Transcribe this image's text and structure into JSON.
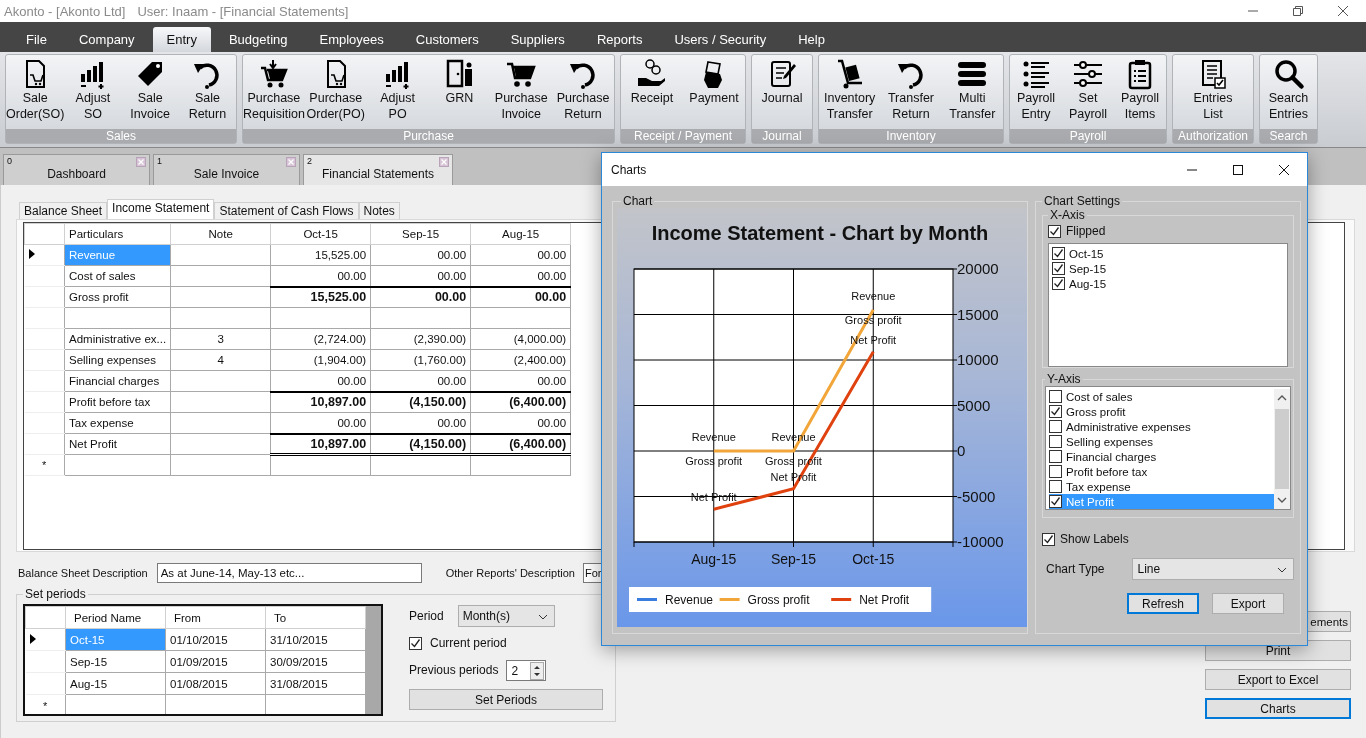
{
  "title_bar": {
    "app": "Akonto - [Akonto Ltd]",
    "user": "User: Inaam - [Financial Statements]"
  },
  "menu": [
    {
      "label": "File",
      "selected": false
    },
    {
      "label": "Company",
      "selected": false
    },
    {
      "label": "Entry",
      "selected": true
    },
    {
      "label": "Budgeting",
      "selected": false
    },
    {
      "label": "Employees",
      "selected": false
    },
    {
      "label": "Customers",
      "selected": false
    },
    {
      "label": "Suppliers",
      "selected": false
    },
    {
      "label": "Reports",
      "selected": false
    },
    {
      "label": "Users / Security",
      "selected": false
    },
    {
      "label": "Help",
      "selected": false
    }
  ],
  "ribbon": [
    {
      "group": "Sales",
      "items": [
        "Sale\nOrder(SO)",
        "Adjust\nSO",
        "Sale\nInvoice",
        "Sale\nReturn"
      ]
    },
    {
      "group": "Purchase",
      "items": [
        "Purchase\nRequisition",
        "Purchase\nOrder(PO)",
        "Adjust\nPO",
        "GRN",
        "Purchase\nInvoice",
        "Purchase\nReturn"
      ]
    },
    {
      "group": "Receipt / Payment",
      "items": [
        "Receipt",
        "Payment"
      ]
    },
    {
      "group": "Journal",
      "items": [
        "Journal"
      ]
    },
    {
      "group": "Inventory",
      "items": [
        "Inventory\nTransfer",
        "Transfer\nReturn",
        "Multi\nTransfer"
      ]
    },
    {
      "group": "Payroll",
      "items": [
        "Payroll\nEntry",
        "Set\nPayroll",
        "Payroll\nItems"
      ]
    },
    {
      "group": "Authorization",
      "items": [
        "Entries\nList"
      ]
    },
    {
      "group": "Search",
      "items": [
        "Search\nEntries"
      ]
    }
  ],
  "document_tabs": [
    {
      "number": "0",
      "label": "Dashboard",
      "selected": false
    },
    {
      "number": "1",
      "label": "Sale Invoice",
      "selected": false
    },
    {
      "number": "2",
      "label": "Financial Statements",
      "selected": true
    }
  ],
  "report_tabs": [
    {
      "label": "Balance Sheet",
      "selected": false
    },
    {
      "label": "Income Statement",
      "selected": true
    },
    {
      "label": "Statement of Cash Flows",
      "selected": false
    },
    {
      "label": "Notes",
      "selected": false
    }
  ],
  "statement_grid": {
    "columns": [
      "Particulars",
      "Note",
      "Oct-15",
      "Sep-15",
      "Aug-15"
    ],
    "new_row_marker": "*",
    "rows": [
      {
        "kind": "line",
        "selected": true,
        "particulars": "Revenue",
        "values": [
          "15,525.00",
          "00.00",
          "00.00"
        ]
      },
      {
        "kind": "line",
        "selected": false,
        "particulars": "Cost of sales",
        "values": [
          "00.00",
          "00.00",
          "00.00"
        ]
      },
      {
        "kind": "subtotal",
        "selected": false,
        "particulars": "Gross profit",
        "values": [
          "15,525.00",
          "00.00",
          "00.00"
        ]
      },
      {
        "kind": "blank",
        "selected": false
      },
      {
        "kind": "line",
        "selected": false,
        "particulars": "Administrative ex...",
        "note": "3",
        "values": [
          "(2,724.00)",
          "(2,390.00)",
          "(4,000.00)"
        ]
      },
      {
        "kind": "line",
        "selected": false,
        "particulars": "Selling expenses",
        "note": "4",
        "values": [
          "(1,904.00)",
          "(1,760.00)",
          "(2,400.00)"
        ]
      },
      {
        "kind": "line",
        "selected": false,
        "particulars": "Financial charges",
        "values": [
          "00.00",
          "00.00",
          "00.00"
        ]
      },
      {
        "kind": "subtotal",
        "selected": false,
        "particulars": "Profit before tax",
        "values": [
          "10,897.00",
          "(4,150.00)",
          "(6,400.00)"
        ]
      },
      {
        "kind": "line",
        "selected": false,
        "particulars": "Tax expense",
        "values": [
          "00.00",
          "00.00",
          "00.00"
        ]
      },
      {
        "kind": "final",
        "selected": false,
        "particulars": "Net Profit",
        "values": [
          "10,897.00",
          "(4,150.00)",
          "(6,400.00)"
        ]
      }
    ]
  },
  "balance_sheet_description": {
    "label": "Balance Sheet Description",
    "value": "As at June-14, May-13 etc..."
  },
  "other_reports_description": {
    "label": "Other Reports' Description",
    "value": "For"
  },
  "set_periods": {
    "title": "Set periods",
    "columns": [
      "Period Name",
      "From",
      "To"
    ],
    "new_row_marker": "*",
    "rows": [
      {
        "selected": true,
        "cells": [
          "Oct-15",
          "01/10/2015",
          "31/10/2015"
        ]
      },
      {
        "selected": false,
        "cells": [
          "Sep-15",
          "01/09/2015",
          "30/09/2015"
        ]
      },
      {
        "selected": false,
        "cells": [
          "Aug-15",
          "01/08/2015",
          "31/08/2015"
        ]
      }
    ],
    "period": {
      "label": "Period",
      "value": "Month(s)"
    },
    "current_period": {
      "label": "Current period",
      "checked": true
    },
    "previous_periods": {
      "label": "Previous periods",
      "value": "2"
    },
    "button": "Set Periods"
  },
  "actions": [
    {
      "label": "ements",
      "focused": false
    },
    {
      "label": "Print",
      "focused": false
    },
    {
      "label": "Export to Excel",
      "focused": false
    },
    {
      "label": "Charts",
      "focused": true
    }
  ],
  "charts_dialog": {
    "title": "Charts",
    "chart_group": "Chart",
    "chart_data": {
      "type": "line",
      "title": "Income Statement - Chart by Month",
      "categories": [
        "Aug-15",
        "Sep-15",
        "Oct-15"
      ],
      "series": [
        {
          "name": "Revenue",
          "color": "#3a7de0",
          "values": [
            null,
            null,
            null
          ],
          "value_labels": [
            "Revenue",
            "Revenue",
            "Revenue"
          ]
        },
        {
          "name": "Gross profit",
          "color": "#f2a63a",
          "values": [
            0,
            0,
            15525
          ],
          "value_labels": [
            "Gross profit",
            "Gross profit",
            "Gross profit"
          ]
        },
        {
          "name": "Net Profit",
          "color": "#e0420f",
          "values": [
            -6400,
            -4150,
            10897
          ],
          "value_labels": [
            "Net Profit",
            "Net Profit",
            "Net Profit"
          ]
        }
      ],
      "ylim": [
        -10000,
        20000
      ],
      "yticks": [
        20000,
        15000,
        10000,
        5000,
        0,
        -5000,
        -10000
      ],
      "grid": true,
      "legend": "bottom"
    },
    "settings": {
      "title": "Chart Settings",
      "x_axis": {
        "title": "X-Axis",
        "flipped": {
          "label": "Flipped",
          "checked": true
        },
        "items": [
          {
            "label": "Oct-15",
            "checked": true
          },
          {
            "label": "Sep-15",
            "checked": true
          },
          {
            "label": "Aug-15",
            "checked": true
          }
        ]
      },
      "y_axis": {
        "title": "Y-Axis",
        "items": [
          {
            "label": "Cost of sales",
            "checked": false,
            "selected": false
          },
          {
            "label": "Gross profit",
            "checked": true,
            "selected": false
          },
          {
            "label": "Administrative expenses",
            "checked": false,
            "selected": false
          },
          {
            "label": "Selling expenses",
            "checked": false,
            "selected": false
          },
          {
            "label": "Financial charges",
            "checked": false,
            "selected": false
          },
          {
            "label": "Profit before tax",
            "checked": false,
            "selected": false
          },
          {
            "label": "Tax expense",
            "checked": false,
            "selected": false
          },
          {
            "label": "Net Profit",
            "checked": true,
            "selected": true
          }
        ]
      },
      "show_labels": {
        "label": "Show Labels",
        "checked": true
      },
      "chart_type": {
        "label": "Chart Type",
        "value": "Line"
      },
      "buttons": [
        {
          "label": "Refresh",
          "focused": true
        },
        {
          "label": "Export",
          "focused": false
        }
      ]
    }
  }
}
